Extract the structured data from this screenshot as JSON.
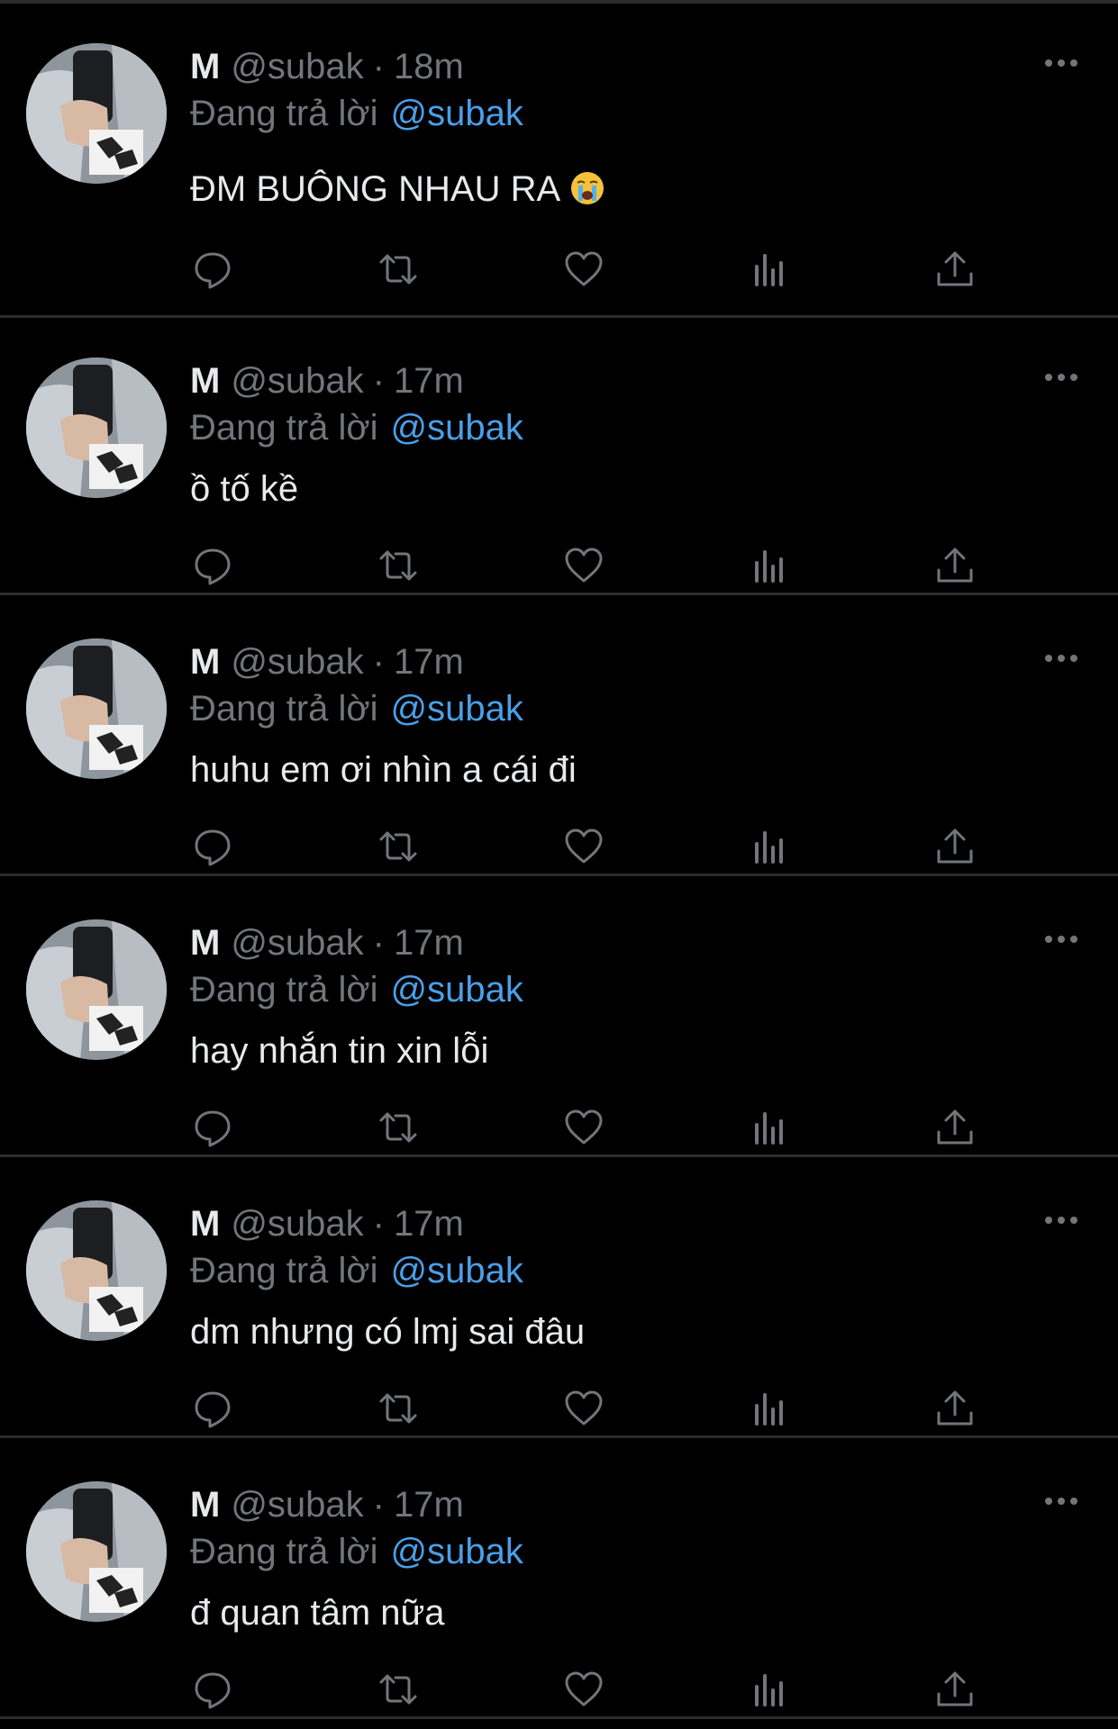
{
  "colors": {
    "background": "#000000",
    "text_primary": "#e7e9ea",
    "text_secondary": "#71767b",
    "link": "#4a9fe8",
    "divider": "#2a2d30"
  },
  "icons": {
    "reply": "speech-bubble-icon",
    "retweet": "retweet-icon",
    "like": "heart-icon",
    "views": "bar-chart-icon",
    "share": "share-icon",
    "more": "more-dots-icon"
  },
  "tweets": [
    {
      "name": "M",
      "handle": "@subak",
      "separator": "·",
      "time": "18m",
      "reply_prefix": "Đang trả lời",
      "reply_to": "@subak",
      "text": "ĐM BUÔNG NHAU RA",
      "emoji": "loudly-crying-face-emoji"
    },
    {
      "name": "M",
      "handle": "@subak",
      "separator": "·",
      "time": "17m",
      "reply_prefix": "Đang trả lời",
      "reply_to": "@subak",
      "text": "ồ tố kề"
    },
    {
      "name": "M",
      "handle": "@subak",
      "separator": "·",
      "time": "17m",
      "reply_prefix": "Đang trả lời",
      "reply_to": "@subak",
      "text": "huhu em ơi nhìn a cái đi"
    },
    {
      "name": "M",
      "handle": "@subak",
      "separator": "·",
      "time": "17m",
      "reply_prefix": "Đang trả lời",
      "reply_to": "@subak",
      "text": "hay nhắn tin xin lỗi"
    },
    {
      "name": "M",
      "handle": "@subak",
      "separator": "·",
      "time": "17m",
      "reply_prefix": "Đang trả lời",
      "reply_to": "@subak",
      "text": "dm nhưng có lmj sai đâu"
    },
    {
      "name": "M",
      "handle": "@subak",
      "separator": "·",
      "time": "17m",
      "reply_prefix": "Đang trả lời",
      "reply_to": "@subak",
      "text": "đ quan tâm nữa"
    }
  ]
}
